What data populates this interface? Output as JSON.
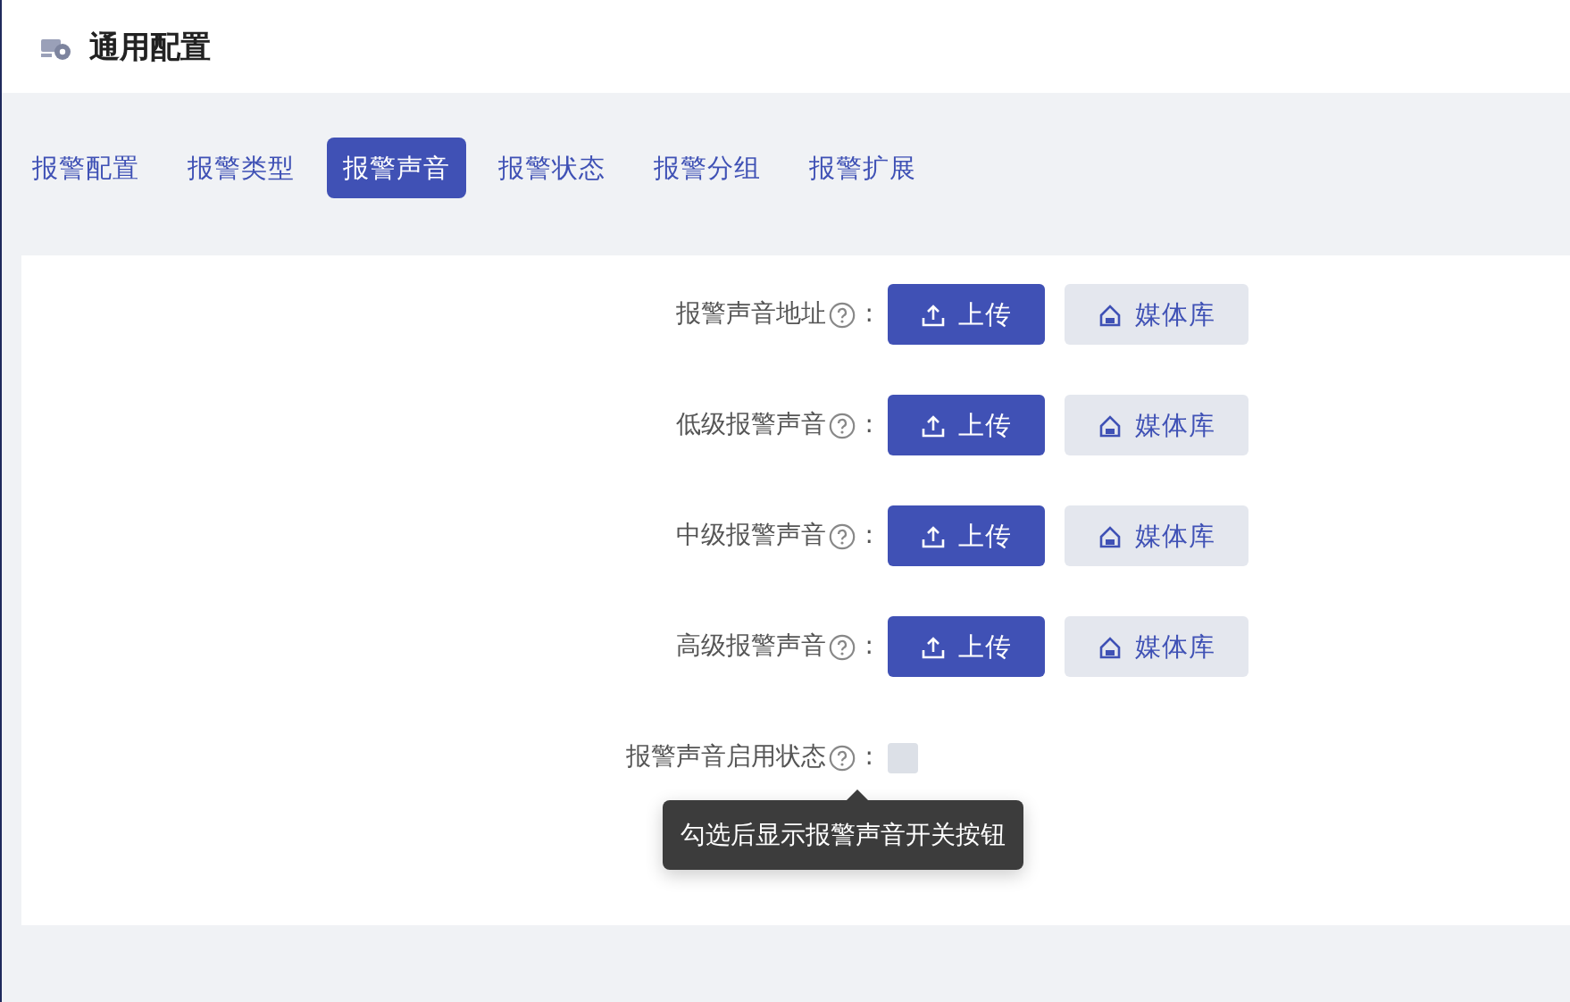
{
  "header": {
    "title": "通用配置"
  },
  "tabs": [
    {
      "label": "报警配置",
      "selected": false
    },
    {
      "label": "报警类型",
      "selected": false
    },
    {
      "label": "报警声音",
      "selected": true
    },
    {
      "label": "报警状态",
      "selected": false
    },
    {
      "label": "报警分组",
      "selected": false
    },
    {
      "label": "报警扩展",
      "selected": false
    }
  ],
  "form": {
    "rows": [
      {
        "kind": "upload",
        "label": "报警声音地址",
        "colon": ":",
        "upload_button": "上传",
        "library_button": "媒体库"
      },
      {
        "kind": "upload",
        "label": "低级报警声音",
        "colon": ":",
        "upload_button": "上传",
        "library_button": "媒体库"
      },
      {
        "kind": "upload",
        "label": "中级报警声音",
        "colon": ":",
        "upload_button": "上传",
        "library_button": "媒体库"
      },
      {
        "kind": "upload",
        "label": "高级报警声音",
        "colon": ":",
        "upload_button": "上传",
        "library_button": "媒体库"
      },
      {
        "kind": "checkbox",
        "label": "报警声音启用状态",
        "colon": ":",
        "checked": false,
        "tooltip": "勾选后显示报警声音开关按钮"
      }
    ]
  }
}
